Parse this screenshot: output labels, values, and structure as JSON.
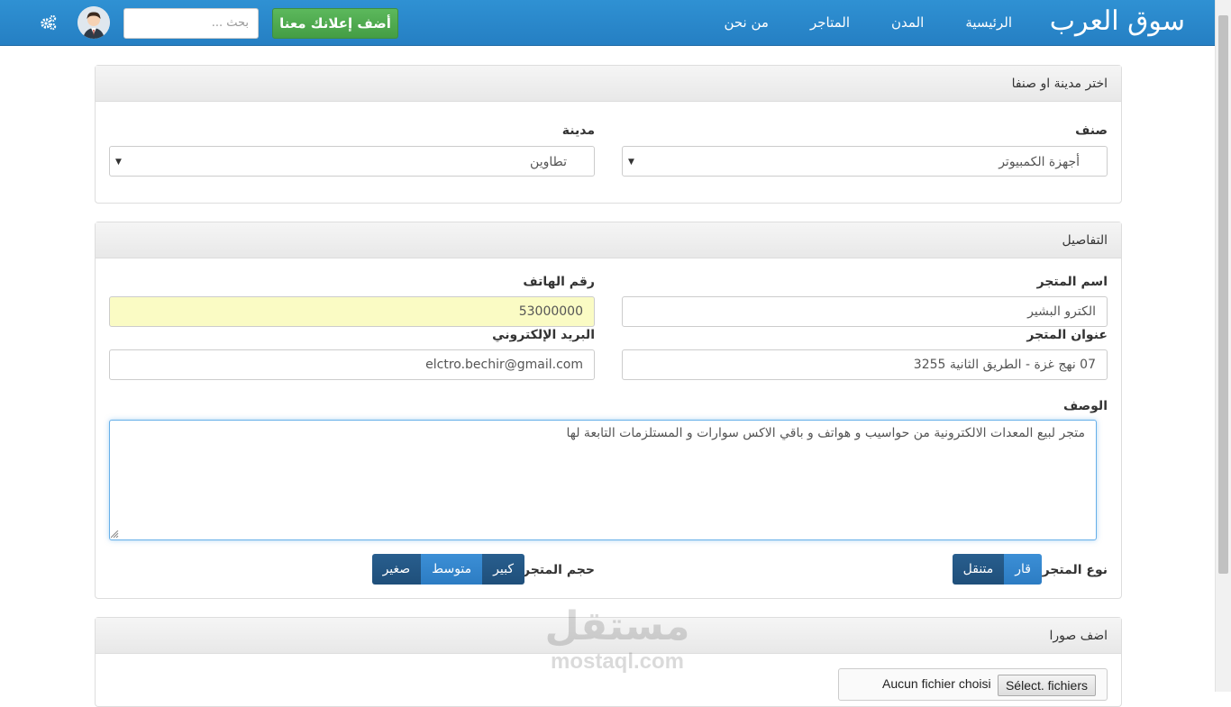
{
  "navbar": {
    "brand": "سوق العرب",
    "links": [
      "الرئيسية",
      "المدن",
      "المتاجر",
      "من نحن"
    ],
    "add_ad_label": "أضف إعلانك معنا",
    "search_placeholder": "بحث ..."
  },
  "panel_filter": {
    "heading": "اختر مدينة او صنفا",
    "category_label": "صنف",
    "category_value": "أجهزة الكمبيوتر",
    "city_label": "مدينة",
    "city_value": "تطاوين"
  },
  "panel_details": {
    "heading": "التفاصيل",
    "store_name_label": "اسم المتجر",
    "store_name_value": "الكترو البشير",
    "phone_label": "رقم الهاتف",
    "phone_value": "53000000",
    "address_label": "عنوان المتجر",
    "address_value": "07 نهج غزة - الطريق الثانية 3255",
    "email_label": "البريد الإلكتروني",
    "email_value": "elctro.bechir@gmail.com",
    "description_label": "الوصف",
    "description_value": "متجر لبيع المعدات الالكترونية من حواسيب و هواتف و باقي الاكس سوارات و المستلزمات التابعة لها",
    "store_type_label": "نوع المتجر",
    "store_type_options": [
      "قار",
      "متنقل"
    ],
    "store_type_selected": "متنقل",
    "store_size_label": "حجم المتجر",
    "store_size_options": [
      "كبير",
      "متوسط",
      "صغير"
    ],
    "store_size_selected": "صغير"
  },
  "panel_images": {
    "heading": "اضف صورا",
    "file_button": "Sélect. fichiers",
    "file_status": "Aucun fichier choisi"
  },
  "watermark": {
    "arabic": "مستقل",
    "latin": "mostaql.com"
  },
  "colors": {
    "navbar": "#2a87cb",
    "add_button": "#5cb85c",
    "toggle": "#337ab7",
    "toggle_active": "#285e8e",
    "phone_field": "#fafbc4"
  }
}
